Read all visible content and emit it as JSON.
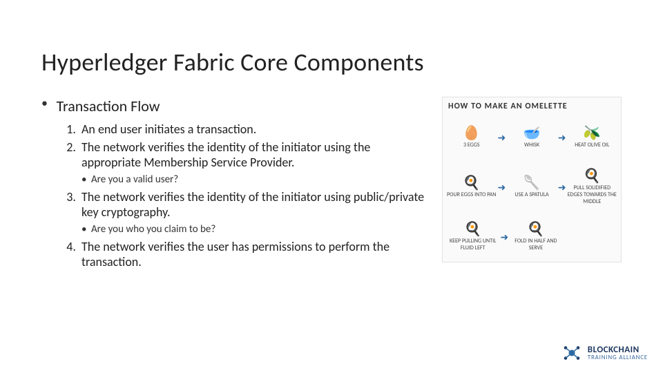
{
  "title": "Hyperledger Fabric Core Components",
  "section_label": "Transaction Flow",
  "steps": [
    {
      "text": "An end user initiates a transaction.",
      "sub": null
    },
    {
      "text": "The network verifies the identity of the initiator using the appropriate Membership Service Provider.",
      "sub": "Are you a valid user?"
    },
    {
      "text": "The network verifies the identity of the initiator using public/private key cryptography.",
      "sub": "Are you who you claim to be?"
    },
    {
      "text": "The network verifies the user has permissions to perform the transaction.",
      "sub": null
    }
  ],
  "illustration": {
    "title": "HOW TO MAKE AN OMELETTE",
    "steps": [
      {
        "icon": "🥚",
        "label": "3 EGGS"
      },
      {
        "icon": "🥣",
        "label": "WHISK"
      },
      {
        "icon": "🫒",
        "label": "HEAT OLIVE OIL"
      },
      {
        "icon": "🍳",
        "label": "POUR EGGS INTO PAN"
      },
      {
        "icon": "🥄",
        "label": "USE A SPATULA"
      },
      {
        "icon": "🍳",
        "label": "PULL SOLIDIFIED EDGES TOWARDS THE MIDDLE"
      },
      {
        "icon": "🍳",
        "label": "KEEP PULLING UNTIL FLUID LEFT"
      },
      {
        "icon": "🍳",
        "label": "FOLD IN HALF AND SERVE"
      }
    ]
  },
  "logo": {
    "line1": "BLOCKCHAIN",
    "line2": "TRAINING ALLIANCE",
    "colors": {
      "primary": "#1a355e",
      "accent": "#3a6aa0"
    }
  }
}
